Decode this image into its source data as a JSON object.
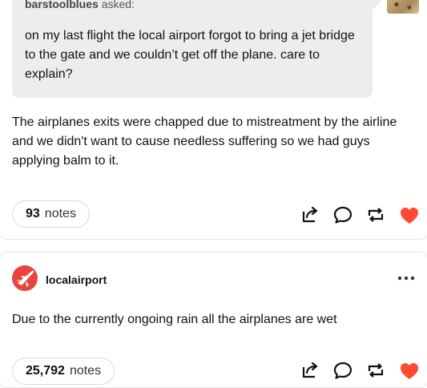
{
  "post1": {
    "asker_name": "barstoolblues",
    "asked_label": "asked:",
    "question": "on my last flight the local airport forgot to bring a jet bridge to the gate and we couldn’t get off the plane. care to explain?",
    "answer": "The airplanes exits were chapped due to mistreatment by the airline and we didn't want to cause needless suffering so we had guys applying balm to it.",
    "notes_count": "93",
    "notes_label": "notes",
    "liked": true
  },
  "post2": {
    "username": "localairport",
    "body": "Due to the currently ongoing rain all the airplanes are wet",
    "notes_count": "25,792",
    "notes_label": "notes"
  },
  "icons": {
    "share": "share-icon",
    "reply": "reply-icon",
    "reblog": "reblog-icon",
    "like": "heart-icon",
    "more": "more-horizontal-icon",
    "avatar_glyph": "airplane-icon"
  },
  "colors": {
    "like_red": "#ff4930",
    "avatar_red": "#e8433d",
    "bubble_gray": "#ededed"
  }
}
